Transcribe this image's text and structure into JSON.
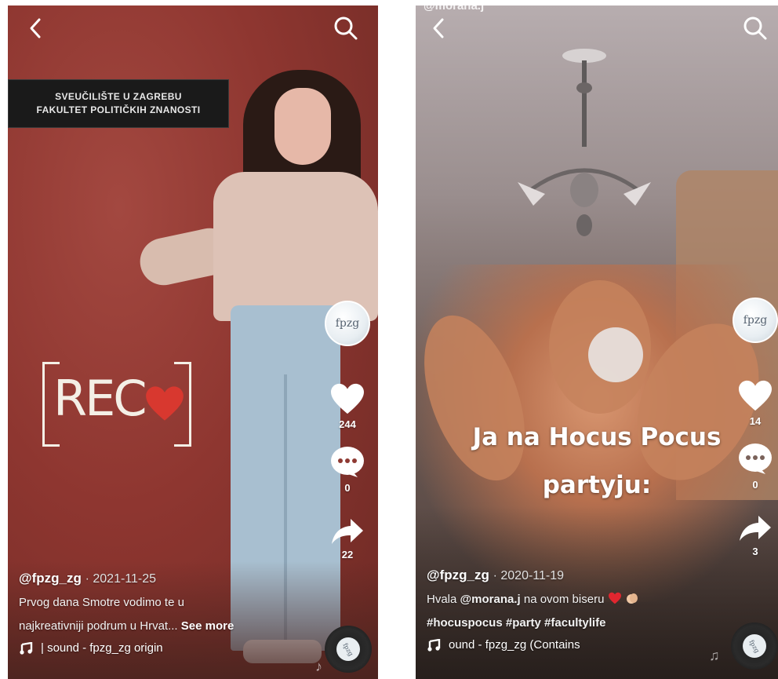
{
  "left_video": {
    "plaque": {
      "line1": "SVEUČILIŠTE U ZAGREBU",
      "line2": "FAKULTET POLITIČKIH ZNANOSTI"
    },
    "overlay": {
      "rec_text": "REC"
    },
    "avatar_text": "fpzg",
    "likes": "244",
    "comments": "0",
    "shares": "22",
    "handle": "@fpzg_zg",
    "date": "· 2021-11-25",
    "caption_line1": "Prvog dana Smotre vodimo te u",
    "caption_line2": "najkreativniji podrum u Hrvat...",
    "see_more": "See more",
    "sound": "| sound - fpzg_zg   origin",
    "disc_text": "fpzg"
  },
  "right_video": {
    "top_handle": "@morana.j",
    "overlay_line1": "Ja na Hocus Pocus",
    "overlay_line2": "partyju:",
    "avatar_text": "fpzg",
    "likes": "14",
    "comments": "0",
    "shares": "3",
    "handle": "@fpzg_zg",
    "date": "· 2020-11-19",
    "caption_prefix": "Hvala ",
    "caption_mention": "@morana.j",
    "caption_suffix": " na ovom biseru",
    "hashtags": "#hocuspocus #party #facultylife",
    "sound": "ound - fpzg_zg (Contains",
    "disc_text": "fpzg"
  },
  "icons": [
    "back-icon",
    "search-icon",
    "heart-icon",
    "comment-icon",
    "share-icon",
    "music-note-icon"
  ],
  "colors": {
    "heart": "#d8382f",
    "text": "#ffffff"
  }
}
